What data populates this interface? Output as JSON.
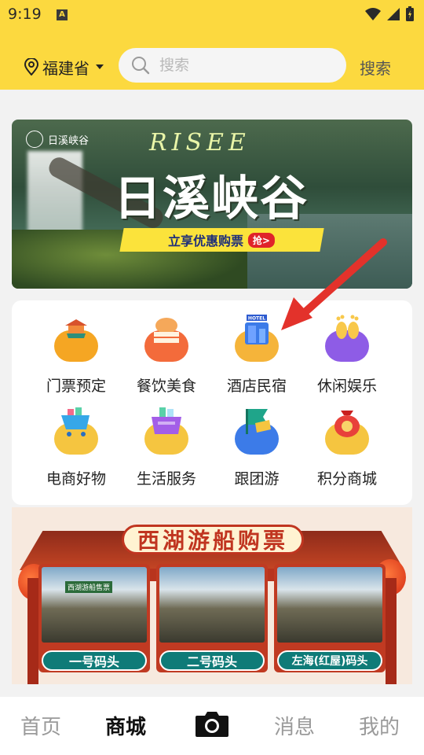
{
  "status_bar": {
    "time": "9:19",
    "sim_icon": "A"
  },
  "header": {
    "location": "福建省",
    "search_placeholder": "搜索",
    "search_button": "搜索"
  },
  "banner": {
    "brand": "日溪峡谷",
    "script_text": "RISEE",
    "title": "日溪峡谷",
    "cta": "立享优惠购票",
    "cta_badge": "抢>"
  },
  "menu": {
    "items": [
      {
        "label": "门票预定",
        "icon": "ticket-temple-icon",
        "color": "#f5a623"
      },
      {
        "label": "餐饮美食",
        "icon": "food-icon",
        "color": "#f36b3b"
      },
      {
        "label": "酒店民宿",
        "icon": "hotel-icon",
        "color": "#3c7be8"
      },
      {
        "label": "休闲娱乐",
        "icon": "footprint-icon",
        "color": "#8e5ce6"
      },
      {
        "label": "电商好物",
        "icon": "shopping-cart-icon",
        "color": "#36a7e8"
      },
      {
        "label": "生活服务",
        "icon": "basket-icon",
        "color": "#a35ee8"
      },
      {
        "label": "跟团游",
        "icon": "flag-icon",
        "color": "#1fa58a"
      },
      {
        "label": "积分商城",
        "icon": "lucky-bag-icon",
        "color": "#e8413a"
      }
    ],
    "hotel_icon_sign": "HOTEL"
  },
  "promo": {
    "title": "西湖游船购票",
    "docks": [
      {
        "label": "一号码头",
        "photo_sign": "西湖游船售票"
      },
      {
        "label": "二号码头"
      },
      {
        "label": "左海(红屋)码头"
      }
    ]
  },
  "tabbar": {
    "tabs": [
      "首页",
      "商城",
      "消息",
      "我的"
    ],
    "active": "商城",
    "center_icon": "camera-icon"
  },
  "colors": {
    "header_yellow": "#fcd93f",
    "annotation_arrow": "#e3322b"
  }
}
